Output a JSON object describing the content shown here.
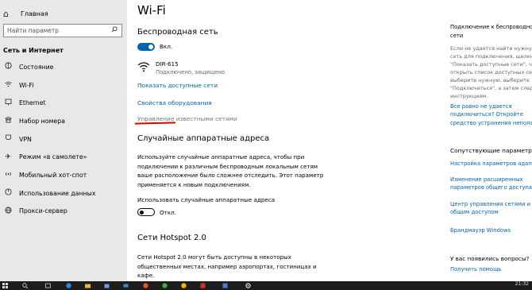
{
  "sidebar": {
    "home_label": "Главная",
    "search_placeholder": "Найти параметр",
    "section_title": "Сеть и Интернет",
    "items": [
      {
        "label": "Состояние",
        "icon": "status-icon"
      },
      {
        "label": "Wi-Fi",
        "icon": "wifi-icon"
      },
      {
        "label": "Ethernet",
        "icon": "ethernet-icon"
      },
      {
        "label": "Набор номера",
        "icon": "dialup-icon"
      },
      {
        "label": "VPN",
        "icon": "vpn-icon"
      },
      {
        "label": "Режим «в самолете»",
        "icon": "airplane-icon"
      },
      {
        "label": "Мобильный хот-спот",
        "icon": "hotspot-icon"
      },
      {
        "label": "Использование данных",
        "icon": "data-usage-icon"
      },
      {
        "label": "Прокси-сервер",
        "icon": "globe-icon"
      }
    ]
  },
  "main": {
    "title": "Wi-Fi",
    "wireless": {
      "heading": "Беспроводная сеть",
      "toggle_label": "Вкл.",
      "network_name": "DIR-615",
      "network_status": "Подключено, защищено",
      "show_networks": "Показать доступные сети",
      "hardware_props": "Свойства оборудования",
      "manage_known": "Управление известными сетями"
    },
    "random": {
      "heading": "Случайные аппаратные адреса",
      "desc_lines": [
        "Используйте случайные аппаратные адреса, чтобы при",
        "подключении к различным беспроводным локальным сетям",
        "ваше расположение было сложнее отследить. Этот параметр",
        "применяется к новым подключениям."
      ],
      "toggle_caption": "Использовать случайные аппаратные адреса",
      "toggle_label": "Откл."
    },
    "hotspot": {
      "heading": "Сети Hotspot 2.0",
      "desc_lines": [
        "Сети Hotspot 2.0 могут быть доступны в некоторых",
        "общественных местах, например аэропортах, гостиницах и",
        "кафе."
      ]
    }
  },
  "right_panel": {
    "title_lines": [
      "Подключение к беспроводной",
      "сети"
    ],
    "desc_lines": [
      "Если не удается найти нужную",
      "сеть для подключения, щелкните",
      "\"Показать доступные сети\", чтобы",
      "открыть список доступных сетей,",
      "выберите нужную, выберите",
      "\"Подключиться\", а затем следуйте",
      "инструкциям."
    ],
    "help_link_lines": [
      "Все равно не удается",
      "подключиться? Откройте",
      "средство устранения неполадок"
    ],
    "related_title": "Сопутствующие параметры",
    "related_links": [
      [
        "Настройка параметров адаптера"
      ],
      [
        "Изменение расширенных",
        "параметров общего доступа"
      ],
      [
        "Центр управления сетями и",
        "общим доступом"
      ],
      [
        "Брандмауэр Windows"
      ]
    ],
    "question": "У вас появились вопросы?",
    "get_help": "Получить помощь"
  },
  "taskbar": {
    "time": "21:32"
  },
  "colors": {
    "accent": "#0063b1",
    "sidebar_bg": "#e8e8e8",
    "taskbar_bg": "#1d1d1d",
    "annotation_red": "#dd0000"
  }
}
